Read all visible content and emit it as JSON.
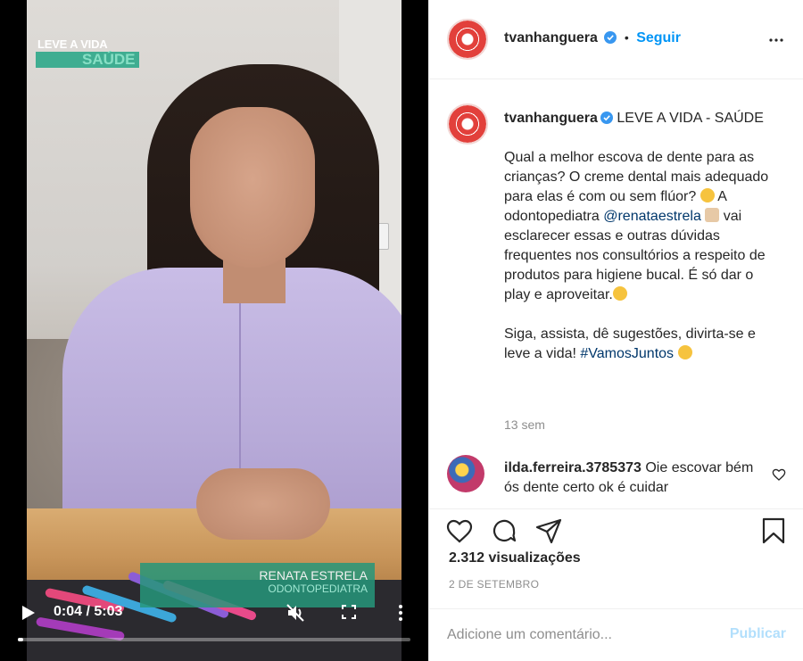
{
  "video": {
    "overlay_title": "LEVE A VIDA",
    "overlay_subtitle": "SAÚDE",
    "lower_third_name": "RENATA ESTRELA",
    "lower_third_role": "ODONTOPEDIATRA",
    "time_display": "0:04 / 5:03",
    "progress_fraction": 0.013
  },
  "header": {
    "username": "tvanhanguera",
    "separator": "•",
    "follow_label": "Seguir"
  },
  "caption": {
    "username": "tvanhanguera",
    "title": "LEVE A VIDA - SAÚDE",
    "paragraph1_a": "Qual a melhor escova de dente para as crianças? O creme dental mais adequado para elas é com ou sem flúor?",
    "paragraph1_b": "A odontopediatra",
    "mention": "@renataestrela",
    "paragraph1_c": "vai esclarecer essas e outras dúvidas frequentes nos consultórios a respeito de produtos para higiene bucal. É só dar o play e aproveitar.",
    "paragraph2_a": "Siga, assista, dê sugestões, divirta-se e leve a vida!",
    "hashtag": "#VamosJuntos",
    "time_ago": "13 sem"
  },
  "comments": [
    {
      "username": "ilda.ferreira.3785373",
      "text": "Oie escovar bém ós dente certo ok é cuidar"
    }
  ],
  "footer": {
    "views": "2.312 visualizações",
    "date": "2 DE SETEMBRO",
    "comment_placeholder": "Adicione um comentário...",
    "publish_label": "Publicar"
  },
  "icons": {
    "play": "play-icon",
    "mute": "mute-icon",
    "fullscreen": "fullscreen-icon",
    "more": "more-vertical-icon",
    "like": "heart-icon",
    "comment": "comment-icon",
    "share": "share-icon",
    "save": "bookmark-icon",
    "verified": "verified-icon"
  },
  "colors": {
    "accent_blue": "#0095f6",
    "publish_disabled": "#b2dffc",
    "brand_red": "#e2403b",
    "overlay_green": "#2fa98a"
  }
}
